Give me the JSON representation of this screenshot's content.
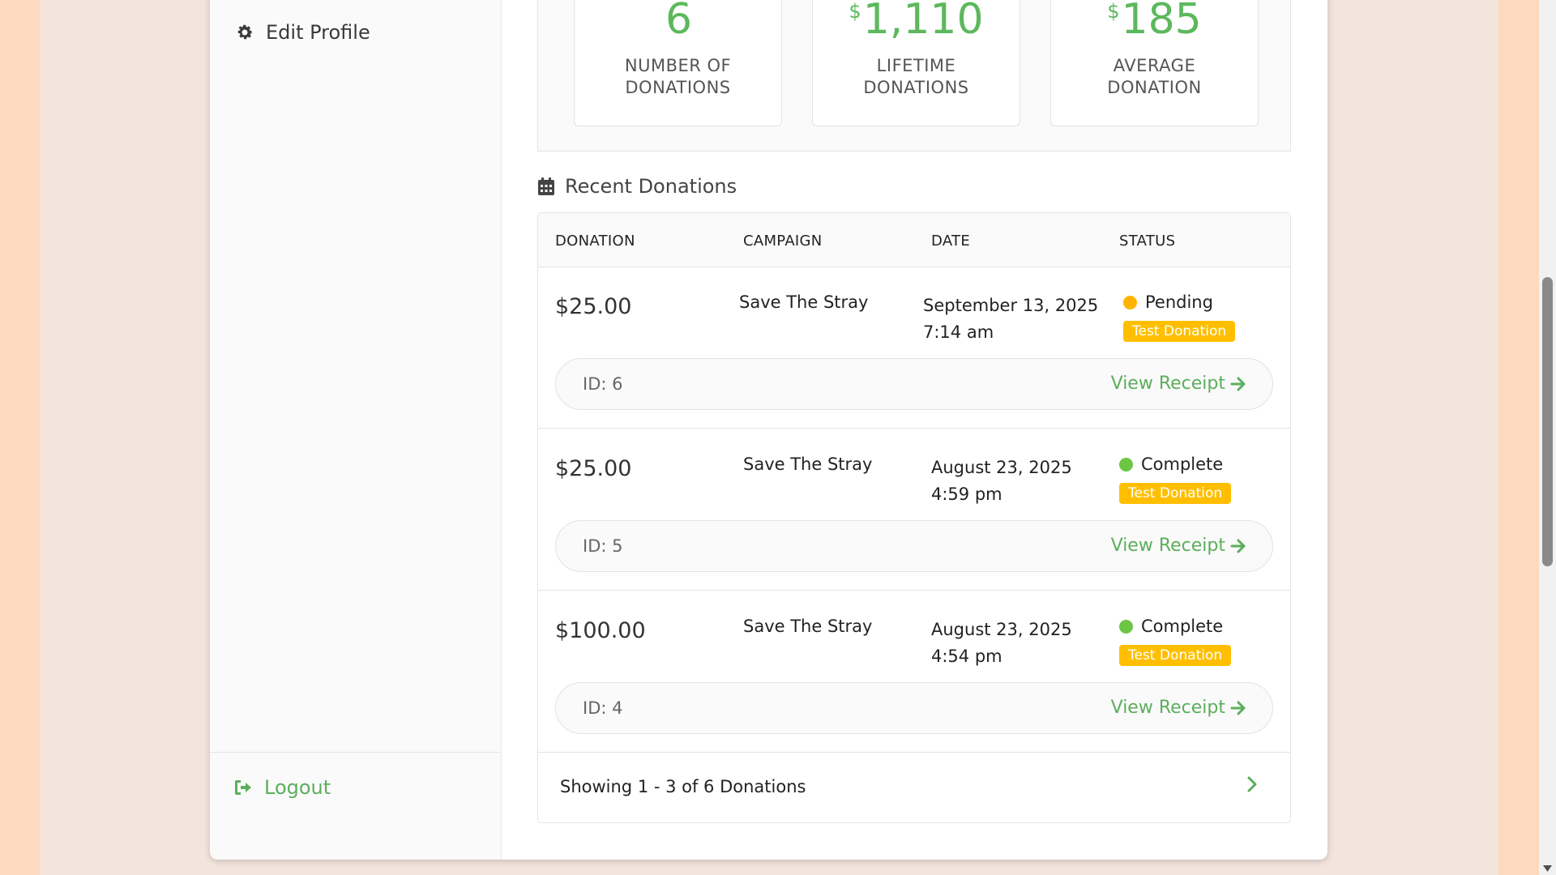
{
  "sidebar": {
    "edit_profile": "Edit Profile",
    "logout": "Logout"
  },
  "stats": [
    {
      "value": "6",
      "currency": "",
      "label": "NUMBER OF\nDONATIONS"
    },
    {
      "value": "1,110",
      "currency": "$",
      "label": "LIFETIME\nDONATIONS"
    },
    {
      "value": "185",
      "currency": "$",
      "label": "AVERAGE\nDONATION"
    }
  ],
  "recent": {
    "title": "Recent Donations",
    "columns": [
      "DONATION",
      "CAMPAIGN",
      "DATE",
      "STATUS"
    ],
    "rows": [
      {
        "amount": "$25.00",
        "campaign": "Save The Stray",
        "date": "September 13, 2025",
        "time": "7:14 am",
        "status": "Pending",
        "status_color": "#ffb400",
        "badge": "Test Donation",
        "id": "ID: 6",
        "receipt": "View Receipt"
      },
      {
        "amount": "$25.00",
        "campaign": "Save The Stray",
        "date": "August 23, 2025",
        "time": "4:59 pm",
        "status": "Complete",
        "status_color": "#6cc644",
        "badge": "Test Donation",
        "id": "ID: 5",
        "receipt": "View Receipt"
      },
      {
        "amount": "$100.00",
        "campaign": "Save The Stray",
        "date": "August 23, 2025",
        "time": "4:54 pm",
        "status": "Complete",
        "status_color": "#6cc644",
        "badge": "Test Donation",
        "id": "ID: 4",
        "receipt": "View Receipt"
      }
    ],
    "footer": "Showing 1 - 3 of 6 Donations"
  },
  "colors": {
    "accent": "#5cae5c",
    "badge": "#ffbf00",
    "page_bg": "#fdd9bf"
  },
  "icons": {
    "edit_profile": "gear-icon",
    "logout": "logout-icon",
    "recent": "calendar-icon",
    "receipt": "arrow-right-icon",
    "next": "chevron-right-icon"
  }
}
